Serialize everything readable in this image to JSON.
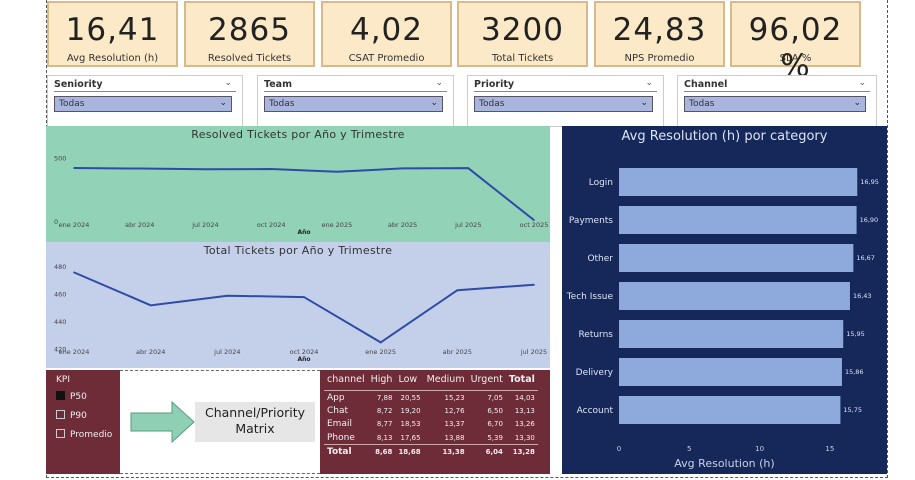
{
  "kpis": [
    {
      "value": "16,41",
      "label": "Avg Resolution (h)"
    },
    {
      "value": "2865",
      "label": "Resolved Tickets"
    },
    {
      "value": "4,02",
      "label": "CSAT Promedio"
    },
    {
      "value": "3200",
      "label": "Total Tickets"
    },
    {
      "value": "24,83",
      "label": "NPS Promedio"
    },
    {
      "value": "96,02 %",
      "label": "SLA %"
    }
  ],
  "slicers": [
    {
      "title": "Seniority",
      "value": "Todas"
    },
    {
      "title": "Team",
      "value": "Todas"
    },
    {
      "title": "Priority",
      "value": "Todas"
    },
    {
      "title": "Channel",
      "value": "Todas"
    }
  ],
  "colors": {
    "kpi_bg": "#fbe9c7",
    "resolved_panel_bg": "#92d2b7",
    "total_panel_bg": "#c4d0ea",
    "line": "#2f4ba8",
    "right_panel_bg": "#16285a",
    "bar": "#8ea9dc",
    "maroon": "#6e2b38",
    "arrow": "#8fcfb4"
  },
  "chart_data": [
    {
      "type": "line",
      "title": "Resolved Tickets por Año y Trimestre",
      "xlabel": "Año",
      "ylabel": "",
      "categories": [
        "ene 2024",
        "abr 2024",
        "jul 2024",
        "oct 2024",
        "ene 2025",
        "abr 2025",
        "jul 2025",
        "oct 2025"
      ],
      "values": [
        426,
        422,
        416,
        418,
        397,
        423,
        425,
        15
      ],
      "y_ticks": [
        "0",
        "500"
      ],
      "ylim": [
        0,
        600
      ],
      "grid": false
    },
    {
      "type": "line",
      "title": "Total Tickets por Año y Trimestre",
      "xlabel": "Año",
      "ylabel": "",
      "categories": [
        "ene 2024",
        "abr 2024",
        "jul 2024",
        "oct 2024",
        "ene 2025",
        "abr 2025",
        "jul 2025"
      ],
      "values": [
        476,
        452,
        459,
        458,
        425,
        463,
        467
      ],
      "y_ticks": [
        "420",
        "440",
        "460",
        "480"
      ],
      "ylim": [
        418,
        485
      ],
      "grid": false
    },
    {
      "type": "bar",
      "orientation": "horizontal",
      "title": "Avg Resolution (h) por category",
      "xlabel": "Avg Resolution (h)",
      "ylabel": "",
      "categories": [
        "Login",
        "Payments",
        "Other",
        "Tech Issue",
        "Returns",
        "Delivery",
        "Account"
      ],
      "values": [
        16.95,
        16.9,
        16.67,
        16.43,
        15.95,
        15.86,
        15.75
      ],
      "value_labels": [
        "16,95",
        "16,90",
        "16,67",
        "16,43",
        "15,95",
        "15,86",
        "15,75"
      ],
      "x_ticks": [
        "0",
        "5",
        "10",
        "15"
      ],
      "xlim": [
        0,
        17.5
      ]
    },
    {
      "type": "table",
      "title": "",
      "columns": [
        "channel",
        "High",
        "Low",
        "Medium",
        "Urgent",
        "Total"
      ],
      "rows": [
        [
          "App",
          "7,88",
          "20,55",
          "15,23",
          "7,05",
          "14,03"
        ],
        [
          "Chat",
          "8,72",
          "19,20",
          "12,76",
          "6,50",
          "13,13"
        ],
        [
          "Email",
          "8,77",
          "18,53",
          "13,37",
          "6,70",
          "13,26"
        ],
        [
          "Phone",
          "8,13",
          "17,65",
          "13,88",
          "5,39",
          "13,30"
        ],
        [
          "Total",
          "8,68",
          "18,68",
          "13,38",
          "6,04",
          "13,28"
        ]
      ]
    }
  ],
  "kpi_selector": {
    "title": "KPI",
    "options": [
      {
        "label": "P50",
        "checked": true
      },
      {
        "label": "P90",
        "checked": false
      },
      {
        "label": "Promedio",
        "checked": false
      }
    ]
  },
  "nav": {
    "label_line1": "Channel/Priority",
    "label_line2": "Matrix"
  }
}
